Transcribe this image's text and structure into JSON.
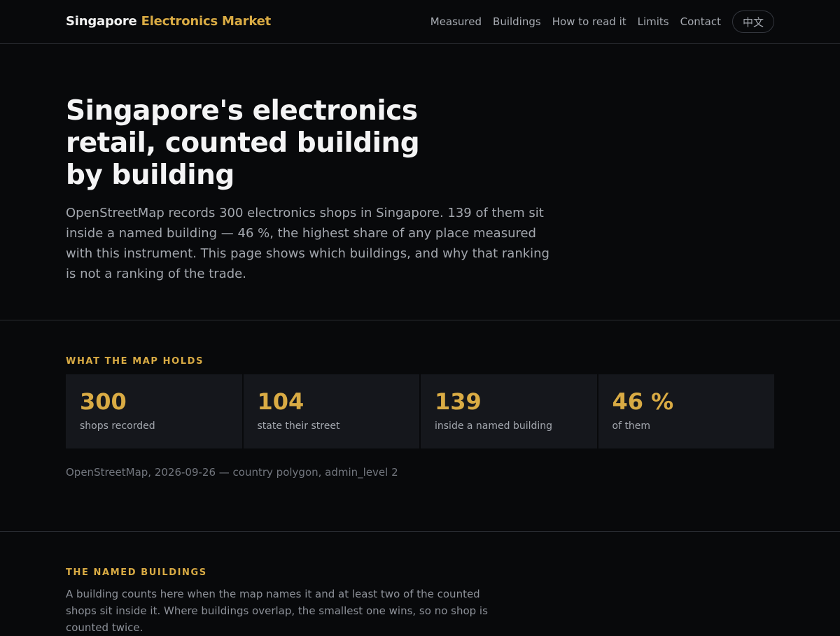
{
  "brand": {
    "part1": "Singapore",
    "part2": "Electronics Market"
  },
  "nav": {
    "items": [
      "Measured",
      "Buildings",
      "How to read it",
      "Limits",
      "Contact"
    ],
    "lang_button": "中文"
  },
  "hero": {
    "title": "Singapore's electronics retail, counted building by building",
    "lede": "OpenStreetMap records 300 electronics shops in Singapore. 139 of them sit inside a named building — 46 %, the highest share of any place measured with this instrument. This page shows which buildings, and why that ranking is not a ranking of the trade."
  },
  "map_holds": {
    "heading": "WHAT THE MAP HOLDS",
    "stats": [
      {
        "value": "300",
        "label": "shops recorded"
      },
      {
        "value": "104",
        "label": "state their street"
      },
      {
        "value": "139",
        "label": "inside a named building"
      },
      {
        "value": "46 %",
        "label": "of them"
      }
    ],
    "source": "OpenStreetMap, 2026-09-26 — country polygon, admin_level 2"
  },
  "named_buildings": {
    "heading": "THE NAMED BUILDINGS",
    "text": "A building counts here when the map names it and at least two of the counted shops sit inside it. Where buildings overlap, the smallest one wins, so no shop is counted twice."
  },
  "colors": {
    "accent": "#d9ab44",
    "background": "#08090b",
    "card": "#15171c"
  }
}
